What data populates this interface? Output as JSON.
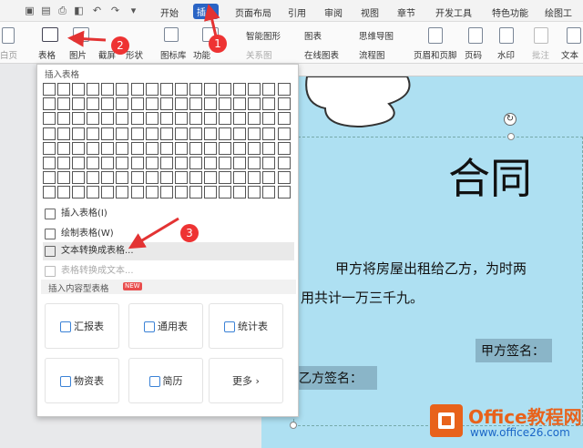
{
  "tabs": [
    "开始",
    "插入",
    "页面布局",
    "引用",
    "审阅",
    "视图",
    "章节",
    "开发工具",
    "特色功能",
    "绘图工"
  ],
  "ribbon": {
    "blank": "白页",
    "table": "表格",
    "picture": "图片",
    "screenshot": "截屏",
    "shapes": "形状",
    "iconlib": "图标库",
    "func": "功能",
    "smartart": "智能图形",
    "chart": "图表",
    "mindmap": "思维导图",
    "online_chart": "在线图表",
    "flowchart": "流程图",
    "relation": "关系图",
    "header_footer": "页眉和页脚",
    "page_num": "页码",
    "watermark": "水印",
    "comment": "批注",
    "textbox": "文本"
  },
  "dropdown": {
    "insert_table_header": "插入表格",
    "items": [
      "插入表格(I)",
      "绘制表格(W)",
      "文本转换成表格...",
      "表格转换成文本..."
    ],
    "content_header": "插入内容型表格",
    "new_badge": "NEW",
    "cards": [
      "汇报表",
      "通用表",
      "统计表",
      "物资表",
      "简历",
      "更多"
    ]
  },
  "document": {
    "title": "合同",
    "para1": "甲方将房屋出租给乙方，为时两",
    "para2": "用共计一万三千九。",
    "sig_a": "甲方签名：",
    "sig_b": "乙方签名："
  },
  "markers": [
    "1",
    "2",
    "3"
  ],
  "watermark": {
    "brand": "Office教程网",
    "url": "www.office26.com"
  },
  "colors": {
    "accent": "#2a64c5",
    "arrow": "#e33333",
    "page": "#aee0f2"
  }
}
